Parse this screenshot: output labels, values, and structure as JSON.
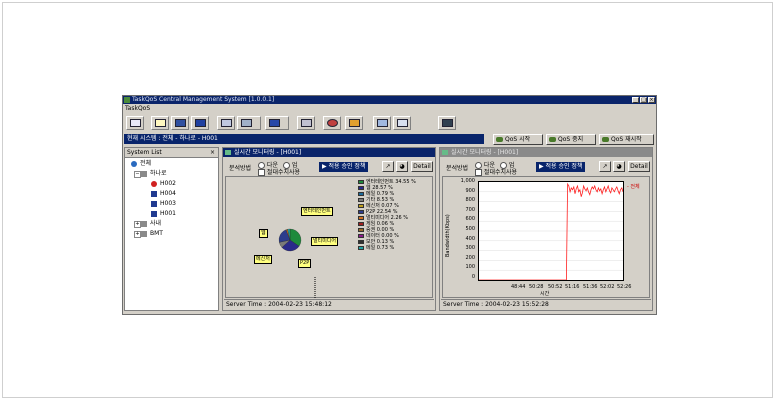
{
  "app": {
    "title": "TaskQoS Central Management System [1.0.0.1]",
    "menu": "TaskQoS"
  },
  "system_bar": {
    "text": "현재 시스템 : 전체 - 하나로 - H001",
    "qos_start": "QoS 시작",
    "qos_stop": "QoS 중지",
    "qos_restart": "QoS 재시작"
  },
  "system_list": {
    "header": "System List",
    "close": "×",
    "tree": [
      {
        "label": "전체",
        "level": 0,
        "icon": "globe-icon"
      },
      {
        "label": "하나로",
        "level": 1,
        "icon": "server-icon"
      },
      {
        "label": "H002",
        "level": 2,
        "icon": "alert-computer-icon"
      },
      {
        "label": "H004",
        "level": 2,
        "icon": "computer-icon"
      },
      {
        "label": "H003",
        "level": 2,
        "icon": "computer-icon"
      },
      {
        "label": "H001",
        "level": 2,
        "icon": "computer-icon"
      },
      {
        "label": "사내",
        "level": 1,
        "icon": "server-icon"
      },
      {
        "label": "BMT",
        "level": 1,
        "icon": "server-icon"
      }
    ]
  },
  "panel_left": {
    "title": "실시간 모니터링 - [H001]",
    "analysis_label": "분석방법",
    "radio_in": "다운",
    "radio_out": "업",
    "abs_label": "절대수치사용",
    "apply_button": "적용 승인 정책",
    "detail_button": "Detail",
    "server_time": "Server Time : 2004-02-23 15:48:12",
    "legend": [
      {
        "label": "엔터테인먼트 34.55 %",
        "color": "#1e8a3c"
      },
      {
        "label": "웹 28.57 %",
        "color": "#2a2a8a"
      },
      {
        "label": "메일 0.79 %",
        "color": "#1c6a9a"
      },
      {
        "label": "기타 8.53 %",
        "color": "#7a7a7a"
      },
      {
        "label": "메신저 0.07 %",
        "color": "#c0a020"
      },
      {
        "label": "P2P 22.54 %",
        "color": "#2c3c8c"
      },
      {
        "label": "멀티미디어 2.26 %",
        "color": "#d07020"
      },
      {
        "label": "게임 0.06 %",
        "color": "#a02020"
      },
      {
        "label": "증권 0.00 %",
        "color": "#9a6a2a"
      },
      {
        "label": "데이터 0.00 %",
        "color": "#8a1a8a"
      },
      {
        "label": "보안 0.13 %",
        "color": "#303030"
      },
      {
        "label": "메일 0.73 %",
        "color": "#20a0a0"
      }
    ],
    "callouts": [
      "엔터테인먼트",
      "웹",
      "멀티미디어",
      "메신저",
      "P2P"
    ],
    "pie": [
      {
        "value": 34.55,
        "color": "#1e8a3c"
      },
      {
        "value": 28.57,
        "color": "#2a2a8a"
      },
      {
        "value": 8.53,
        "color": "#7a7a7a"
      },
      {
        "value": 22.54,
        "color": "#2c3c8c"
      },
      {
        "value": 2.26,
        "color": "#d07020"
      },
      {
        "value": 3.55,
        "color": "#20a0a0"
      }
    ]
  },
  "panel_right": {
    "title": "실시간 모니터링 - [H001]",
    "analysis_label": "분석방법",
    "radio_in": "다운",
    "radio_out": "업",
    "abs_label": "절대수치사용",
    "apply_button": "적용 승인 정책",
    "detail_button": "Detail",
    "server_time": "Server Time : 2004-02-23 15:52:28",
    "series_legend": "- 전체",
    "chart_data": {
      "type": "line",
      "ylabel": "Bandwidth(Kbps)",
      "xlabel": "시간",
      "y_ticks": [
        "1,000",
        "900",
        "800",
        "700",
        "600",
        "500",
        "400",
        "300",
        "200",
        "100",
        "0"
      ],
      "x_ticks": [
        "48:44",
        "50:28",
        "50:52",
        "51:16",
        "51:36",
        "52:02",
        "52:26"
      ],
      "ylim": [
        0,
        1000
      ],
      "series": [
        {
          "name": "전체",
          "color": "#ff2020",
          "values": [
            0,
            0,
            0,
            0,
            0,
            0,
            0,
            0,
            0,
            0,
            0,
            0,
            0,
            0,
            0,
            0,
            0,
            0,
            0,
            0,
            0,
            0,
            0,
            0,
            0,
            0,
            0,
            0,
            0,
            0,
            0,
            0,
            0,
            0,
            0,
            0,
            0,
            0,
            0,
            0,
            0,
            0,
            0,
            0,
            0,
            0,
            0,
            0,
            0,
            0,
            0,
            0,
            0,
            0,
            0,
            0,
            0,
            0,
            0,
            0,
            0,
            0,
            0,
            0,
            0,
            0,
            0,
            0,
            0,
            0,
            0,
            0,
            980,
            960,
            900,
            940,
            920,
            950,
            880,
            930,
            960,
            900,
            920,
            850,
            890,
            960,
            930,
            910,
            940,
            900,
            870,
            920,
            950,
            930,
            960,
            920,
            900,
            940,
            910,
            930,
            880,
            920,
            950,
            900,
            930,
            960,
            910,
            890,
            940,
            920,
            900,
            930,
            950,
            910,
            880,
            920,
            940,
            900
          ]
        }
      ]
    }
  }
}
